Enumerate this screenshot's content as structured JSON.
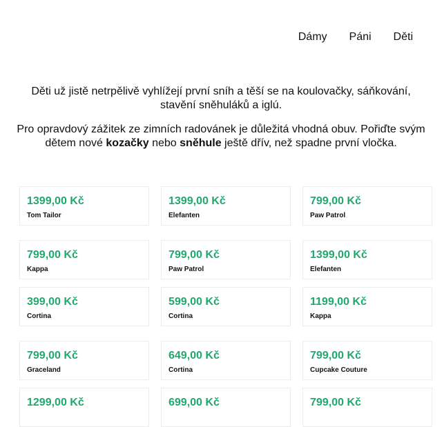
{
  "nav": {
    "items": [
      "Dámy",
      "Páni",
      "Děti"
    ]
  },
  "intro": {
    "p1": "Děti už jistě netrpělivě vyhlížejí první sníh a těší se na koulovačky, sáňkování, stavění sněhuláků a iglú.",
    "p2_a": "Pro opravdový zážitek ze zimních radovánek je důležitá vhodná obuv. Pořiďte svým dětem nové ",
    "p2_bold1": "kozačky",
    "p2_b": " nebo ",
    "p2_bold2": "sněhule",
    "p2_c": " ještě dřív, než spadne první vločka."
  },
  "products": [
    {
      "price": "1399,00 Kč",
      "brand": "Tom Tailor"
    },
    {
      "price": "1399,00 Kč",
      "brand": "Elefanten"
    },
    {
      "price": "799,00 Kč",
      "brand": "Paw Patrol"
    },
    {
      "price": "799,00 Kč",
      "brand": "Kappa"
    },
    {
      "price": "799,00 Kč",
      "brand": "Paw Patrol"
    },
    {
      "price": "1399,00 Kč",
      "brand": "Elefanten"
    },
    {
      "price": "399,00 Kč",
      "brand": "Cortina"
    },
    {
      "price": "599,00 Kč",
      "brand": "Cortina"
    },
    {
      "price": "1199,00 Kč",
      "brand": "Kappa"
    },
    {
      "price": "799,00 Kč",
      "brand": "Graceland"
    },
    {
      "price": "649,00 Kč",
      "brand": "Cortina"
    },
    {
      "price": "799,00 Kč",
      "brand": "Cupcake Couture"
    },
    {
      "price": "1299,00 Kč",
      "brand": ""
    },
    {
      "price": "699,00 Kč",
      "brand": ""
    },
    {
      "price": "799,00 Kč",
      "brand": ""
    }
  ]
}
